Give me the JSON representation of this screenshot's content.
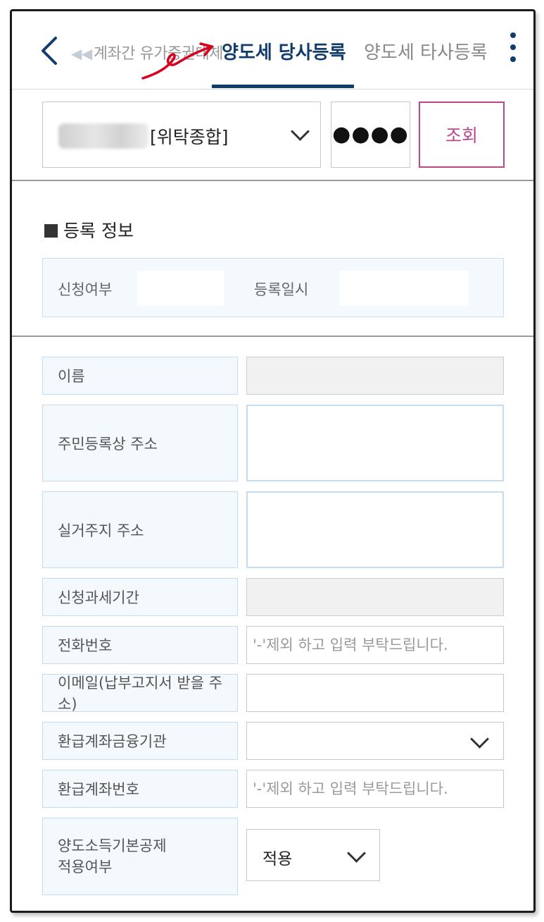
{
  "header": {
    "prev_tab_label": "계좌간 유가증권대체",
    "active_tab_label": "양도세 당사등록",
    "next_tab_label": "양도세 타사등록"
  },
  "account": {
    "selected_account_suffix": "[위탁종합]",
    "password_mask": "●●●●",
    "query_button_label": "조회"
  },
  "registration_info": {
    "section_title": "등록 정보",
    "application_status_label": "신청여부",
    "registered_at_label": "등록일시"
  },
  "form": {
    "name_label": "이름",
    "resident_address_label": "주민등록상 주소",
    "actual_address_label": "실거주지 주소",
    "tax_period_label": "신청과세기간",
    "phone_label": "전화번호",
    "phone_placeholder": "'-'제외 하고 입력 부탁드립니다.",
    "email_label": "이메일(납부고지서 받을 주소)",
    "refund_bank_label": "환급계좌금융기관",
    "refund_account_label": "환급계좌번호",
    "refund_account_placeholder": "'-'제외 하고 입력 부탁드립니다.",
    "deduction_label_line1": "양도소득기본공제",
    "deduction_label_line2": "적용여부",
    "deduction_value": "적용"
  },
  "colors": {
    "brand_navy": "#123c6b",
    "query_accent": "#b9478a",
    "label_bg": "#f4f9fd",
    "annotation_red": "#d8001c"
  },
  "icons": [
    "back-chevron-icon",
    "double-arrow-left-icon",
    "more-vertical-icon",
    "chevron-down-icon",
    "red-arrow-annotation"
  ]
}
